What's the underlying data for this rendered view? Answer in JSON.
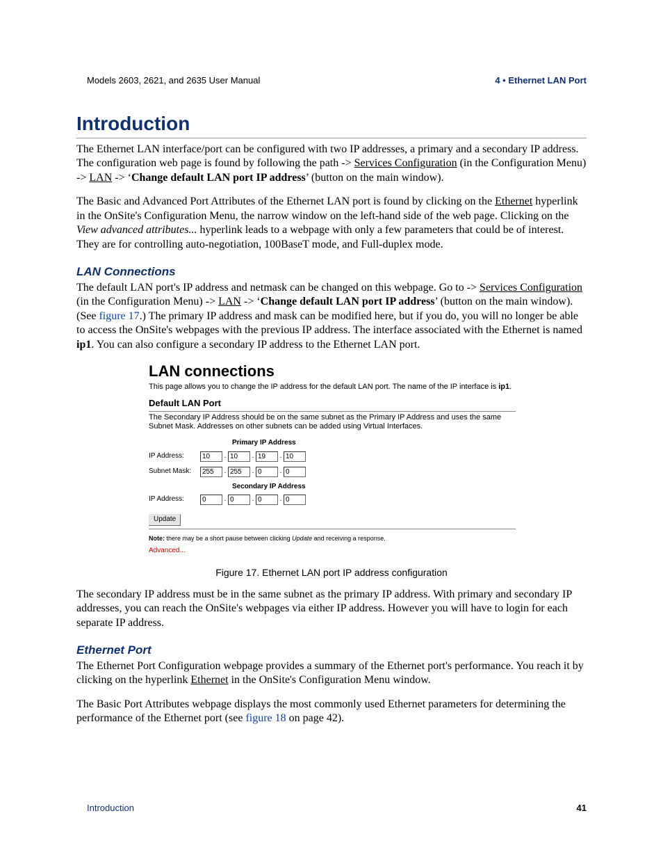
{
  "header": {
    "left": "Models 2603, 2621, and 2635 User Manual",
    "right": "4 • Ethernet LAN Port"
  },
  "intro": {
    "title": "Introduction",
    "p1_a": "The Ethernet LAN interface/port can be configured with two IP addresses, a primary and a secondary IP address. The configuration web page is found by following the path -> ",
    "p1_link1": "Services Configuration",
    "p1_b": " (in the Configuration Menu) -> ",
    "p1_link2": "LAN",
    "p1_c": " -> ‘",
    "p1_bold": "Change default LAN port IP address",
    "p1_d": "’ (button on the main window).",
    "p2_a": "The Basic and Advanced Port Attributes of the Ethernet LAN port is found by clicking on the ",
    "p2_link1": "Ethernet",
    "p2_b": " hyperlink in the OnSite's Configuration Menu, the narrow window on the left-hand side of the web page. Clicking on the ",
    "p2_ital": "View advanced attributes...",
    "p2_c": " hyperlink leads to a webpage with only a few parameters that could be of interest. They are for controlling auto-negotiation, 100BaseT mode, and Full-duplex mode."
  },
  "lan": {
    "heading": "LAN Connections",
    "p1_a": "The default LAN port's IP address and netmask can be changed on this webpage. Go to -> ",
    "p1_link1": "Services Configuration",
    "p1_b": " (in the Configuration Menu) -> ",
    "p1_link2": "LAN",
    "p1_c": " -> ‘",
    "p1_bold": "Change default LAN port IP address",
    "p1_d": "’ (button on the main window). (See ",
    "p1_figref": "figure 17",
    "p1_e": ".) The primary IP address and mask can be modified here, but if you do, you will no longer be able to access the OnSite's webpages with the previous IP address. The interface associated with the Ethernet is named ",
    "p1_bold2": "ip1",
    "p1_f": ". You can also configure a secondary IP address to the Ethernet LAN port."
  },
  "figure": {
    "title": "LAN connections",
    "intro_a": "This page allows you to change the IP address for the default LAN port. The name of the IP interface is ",
    "intro_bold": "ip1",
    "intro_b": ".",
    "section_title": "Default LAN Port",
    "section_desc": "The Secondary IP Address should be on the same subnet as the Primary IP Address and uses the same Subnet Mask. Addresses on other subnets can be added using Virtual Interfaces.",
    "primary_header": "Primary IP Address",
    "secondary_header": "Secondary IP Address",
    "row_ip_label": "IP Address:",
    "row_mask_label": "Subnet Mask:",
    "primary_ip": [
      "10",
      "10",
      "19",
      "10"
    ],
    "subnet_mask": [
      "255",
      "255",
      "0",
      "0"
    ],
    "secondary_ip": [
      "0",
      "0",
      "0",
      "0"
    ],
    "update_btn": "Update",
    "note_label": "Note:",
    "note_a": " there may be a short pause between clicking ",
    "note_ital": "Update",
    "note_b": " and receiving a response.",
    "advanced": "Advanced..."
  },
  "figure_caption": "Figure 17. Ethernet LAN port IP address configuration",
  "post_figure_p": "The secondary IP address must be in the same subnet as the primary IP address. With primary and secondary IP addresses, you can reach the OnSite's webpages via either IP address. However you will have to login for each separate IP address.",
  "eth": {
    "heading": "Ethernet Port",
    "p1_a": "The Ethernet Port Configuration webpage provides a summary of the Ethernet port's performance. You reach it by clicking on the hyperlink ",
    "p1_link": "Ethernet",
    "p1_b": " in the OnSite's Configuration Menu window.",
    "p2_a": "The Basic Port Attributes webpage displays the most commonly used Ethernet parameters for determining the performance of the Ethernet port (see ",
    "p2_figref": "figure 18",
    "p2_b": " on page 42)."
  },
  "footer": {
    "left": "Introduction",
    "right": "41"
  }
}
